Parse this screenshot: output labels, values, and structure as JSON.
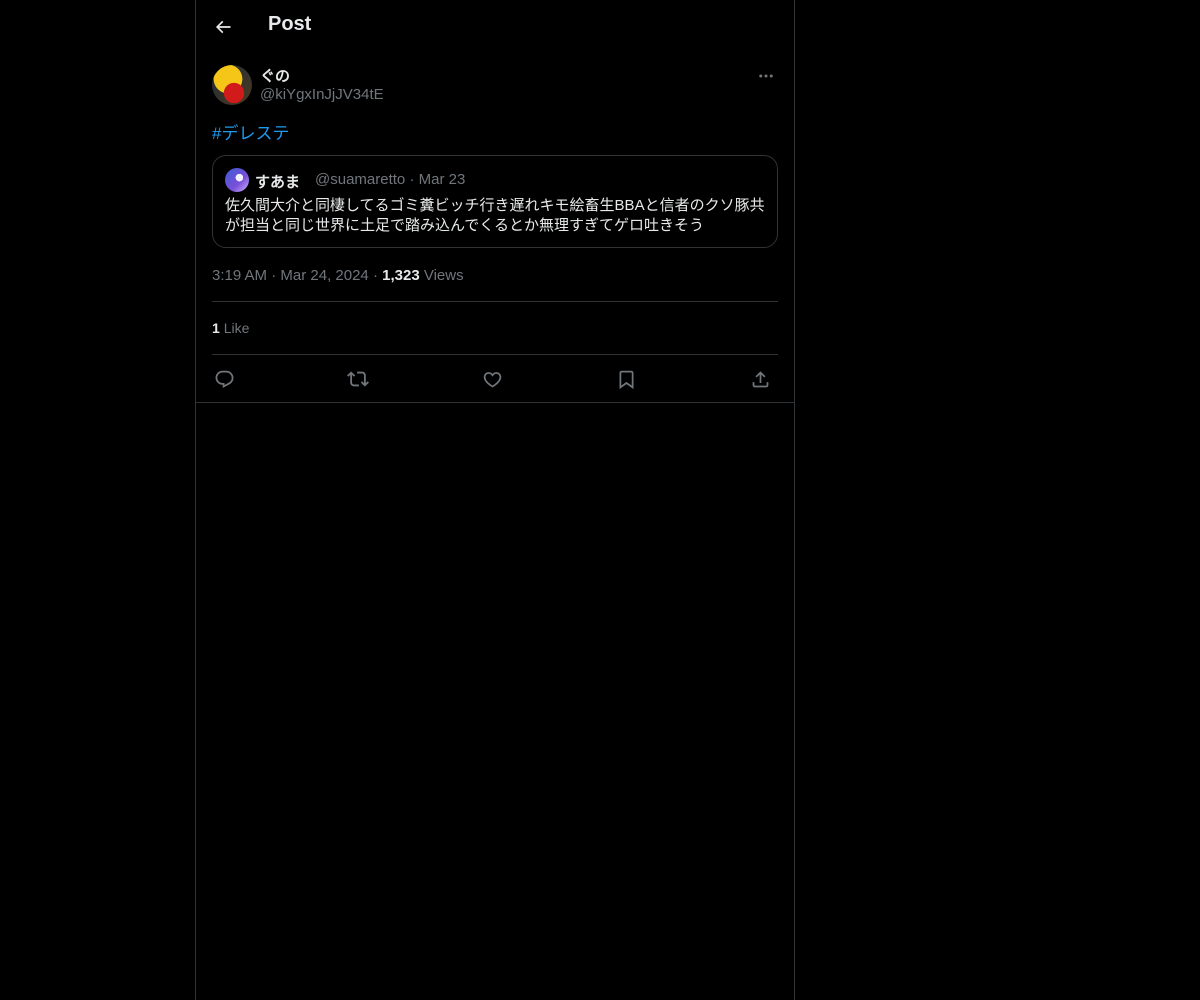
{
  "header": {
    "title": "Post",
    "back_icon": "arrow-left-icon"
  },
  "post": {
    "author": {
      "display_name": "ぐの",
      "handle": "@kiYgxInJjJV34tE",
      "avatar_icon": "avatar"
    },
    "hashtag": "#デレステ",
    "quote": {
      "display_name": "すあま",
      "handle": "@suamaretto",
      "separator": "·",
      "date": "Mar 23",
      "text": "佐久間大介と同棲してるゴミ糞ビッチ行き遅れキモ絵畜生BBAと信者のクソ豚共が担当と同じ世界に土足で踏み込んでくるとか無理すぎてゲロ吐きそう"
    },
    "meta": {
      "time": "3:19 AM",
      "sep1": "·",
      "date": "Mar 24, 2024",
      "sep2": "·",
      "views_count": "1,323",
      "views_label": "Views"
    },
    "likes": {
      "count": "1",
      "label": "Like"
    }
  },
  "actions": {
    "reply": "reply-icon",
    "repost": "repost-icon",
    "like": "like-heart-icon",
    "bookmark": "bookmark-icon",
    "share": "share-icon"
  },
  "colors": {
    "background": "#000000",
    "text": "#e7e9ea",
    "secondary": "#71767b",
    "accent": "#1d9bf0",
    "border": "#2f3336"
  }
}
